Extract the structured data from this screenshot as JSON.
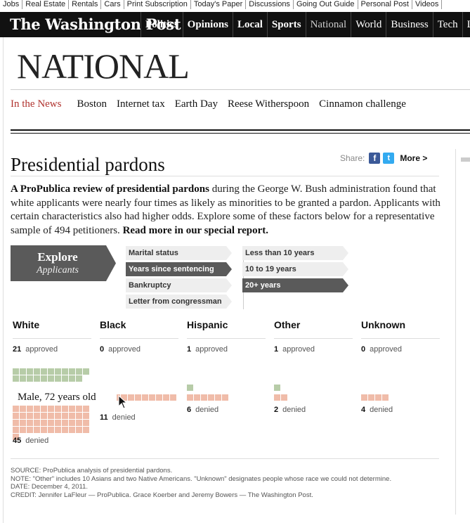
{
  "utility_nav": [
    "Jobs",
    "Real Estate",
    "Rentals",
    "Cars",
    "Print Subscription",
    "Today's Paper",
    "Discussions",
    "Going Out Guide",
    "Personal Post",
    "Videos"
  ],
  "logo": "The Washington Post",
  "main_nav": [
    "Politics",
    "Opinions",
    "Local",
    "Sports",
    "National",
    "World",
    "Business",
    "Tech",
    "Lifestyle"
  ],
  "section_title": "NATIONAL",
  "sub_nav": [
    "In the News",
    "Boston",
    "Internet tax",
    "Earth Day",
    "Reese Witherspoon",
    "Cinnamon challenge"
  ],
  "headline": "Presidential pardons",
  "share": {
    "label": "Share:",
    "facebook": "f",
    "twitter": "t",
    "more": "More >"
  },
  "intro": {
    "lead": "A ProPublica review of presidential pardons",
    "body": " during the George W. Bush administration found that white applicants were nearly four times as likely as minorities to be granted a pardon. Applicants with certain characteristics also had higher odds. Explore some of these factors below for a representative sample of 494 petitioners. ",
    "link": "Read more in our special report."
  },
  "explore": {
    "title": "Explore",
    "subtitle": "Applicants"
  },
  "factors": [
    {
      "label": "Marital status",
      "selected": false
    },
    {
      "label": "Years since sentencing",
      "selected": true
    },
    {
      "label": "Bankruptcy",
      "selected": false
    },
    {
      "label": "Letter from congressman",
      "selected": false
    }
  ],
  "options": [
    {
      "label": "Less than 10 years",
      "selected": false
    },
    {
      "label": "10 to 19 years",
      "selected": false
    },
    {
      "label": "20+ years",
      "selected": true
    }
  ],
  "races": [
    {
      "name": "White",
      "approved": "21",
      "approved_label": "approved",
      "denied": "45",
      "denied_label": "denied"
    },
    {
      "name": "Black",
      "approved": "0",
      "approved_label": "approved",
      "denied": "11",
      "denied_label": "denied"
    },
    {
      "name": "Hispanic",
      "approved": "1",
      "approved_label": "approved",
      "denied": "6",
      "denied_label": "denied"
    },
    {
      "name": "Other",
      "approved": "1",
      "approved_label": "approved",
      "denied": "2",
      "denied_label": "denied"
    },
    {
      "name": "Unknown",
      "approved": "0",
      "approved_label": "approved",
      "denied": "4",
      "denied_label": "denied"
    }
  ],
  "tooltip": "Male, 72 years old",
  "notes": {
    "source": "SOURCE: ProPublica analysis of presidential pardons.",
    "note": "NOTE: \"Other\" includes 10 Asians and two Native Americans. \"Unknown\" designates people whose race we could not determine.",
    "date": "DATE: December 4, 2011.",
    "credit": "CREDIT: Jennifer LaFleur — ProPublica. Grace Koerber and Jeremy Bowers — The Washington Post."
  },
  "colors": {
    "approved": "#b7cca8",
    "denied": "#f0bca9",
    "highlight": "#c0392b",
    "accent_red": "#b0322e",
    "explore_bg": "#5a5a5a"
  }
}
